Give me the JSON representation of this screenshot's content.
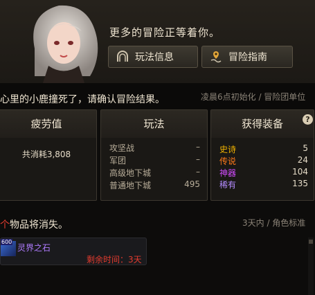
{
  "header": {
    "greeting": "更多的冒险正等着你。",
    "play_info_label": "玩法信息",
    "adventure_guide_label": "冒险指南"
  },
  "bar": {
    "message_prefix": "心里的小鹿撞死了，",
    "message_main": "请确认冒险结果。",
    "reset_info": "凌晨6点初始化 / 冒险团单位"
  },
  "fatigue": {
    "title": "疲劳值",
    "total_label": "共消耗",
    "total_value": "3,808"
  },
  "play": {
    "title": "玩法",
    "rows": [
      {
        "label": "攻坚战",
        "value": "–"
      },
      {
        "label": "军团",
        "value": "–"
      },
      {
        "label": "高级地下城",
        "value": "–"
      },
      {
        "label": "普通地下城",
        "value": "495"
      }
    ]
  },
  "equipment": {
    "title": "获得装备",
    "help": "?",
    "rows": [
      {
        "label": "史诗",
        "value": "5",
        "color": "#f2b300"
      },
      {
        "label": "传说",
        "value": "24",
        "color": "#ff7a1a"
      },
      {
        "label": "神器",
        "value": "104",
        "color": "#d24cff"
      },
      {
        "label": "稀有",
        "value": "135",
        "color": "#b48cff"
      }
    ]
  },
  "vanish": {
    "title_highlight": "个",
    "title_rest": "物品将消失。",
    "hint": "3天内 / 角色标准"
  },
  "item": {
    "badge": "600",
    "name": "灵界之石",
    "time_label": "剩余时间：3天"
  },
  "colors": {
    "accent_red": "#e23b2e",
    "item_purple": "#b07cff"
  }
}
